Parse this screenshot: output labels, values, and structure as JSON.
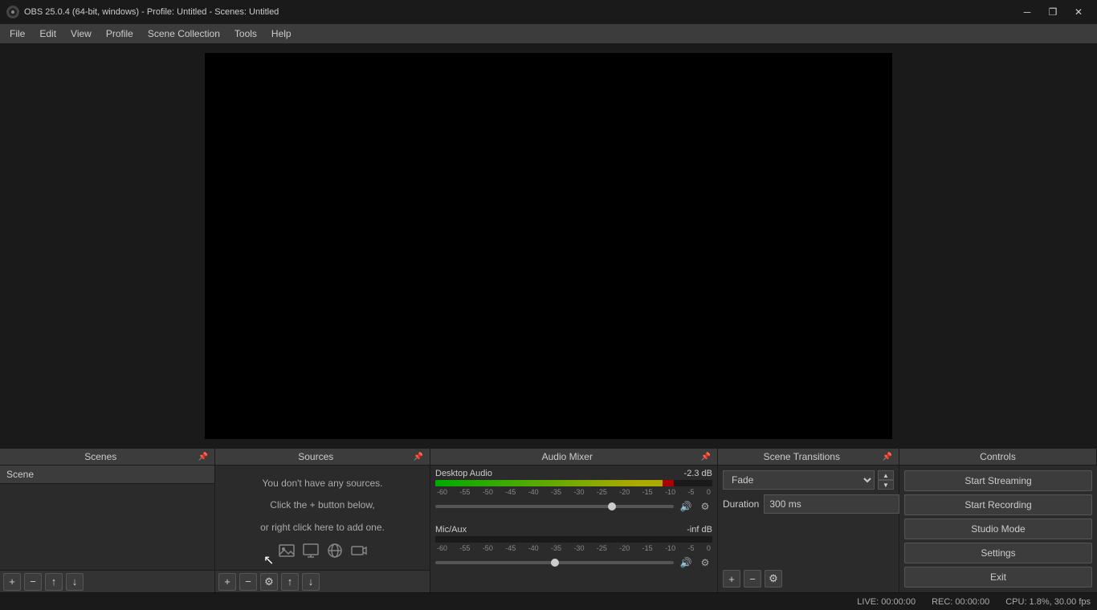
{
  "titlebar": {
    "title": "OBS 25.0.4 (64-bit, windows) - Profile: Untitled - Scenes: Untitled",
    "minimize": "─",
    "maximize": "❐",
    "close": "✕"
  },
  "menubar": {
    "items": [
      "File",
      "Edit",
      "View",
      "Profile",
      "Scene Collection",
      "Tools",
      "Help"
    ]
  },
  "panels": {
    "scenes": {
      "label": "Scenes",
      "items": [
        "Scene"
      ],
      "toolbar": {
        "add": "+",
        "remove": "−",
        "up": "↑",
        "down": "↓"
      }
    },
    "sources": {
      "label": "Sources",
      "empty_line1": "You don't have any sources.",
      "empty_line2": "Click the + button below,",
      "empty_line3": "or right click here to add one.",
      "toolbar": {
        "add": "+",
        "remove": "−",
        "settings": "⚙",
        "up": "↑",
        "down": "↓"
      }
    },
    "audiomixer": {
      "label": "Audio Mixer",
      "channels": [
        {
          "name": "Desktop Audio",
          "db": "-2.3 dB",
          "green_width_pct": 72,
          "yellow_start_pct": 72,
          "yellow_width_pct": 10,
          "red_start_pct": 82,
          "red_width_pct": 4,
          "volume_pct": 74,
          "scale": [
            "-60",
            "-55",
            "-50",
            "-45",
            "-40",
            "-35",
            "-30",
            "-25",
            "-20",
            "-15",
            "-10",
            "-5",
            "0"
          ]
        },
        {
          "name": "Mic/Aux",
          "db": "-inf dB",
          "green_width_pct": 0,
          "yellow_start_pct": 0,
          "yellow_width_pct": 0,
          "red_start_pct": 0,
          "red_width_pct": 0,
          "volume_pct": 50,
          "scale": [
            "-60",
            "-55",
            "-50",
            "-45",
            "-40",
            "-35",
            "-30",
            "-25",
            "-20",
            "-15",
            "-10",
            "-5",
            "0"
          ]
        }
      ]
    },
    "transitions": {
      "label": "Scene Transitions",
      "transition_value": "Fade",
      "duration_label": "Duration",
      "duration_value": "300 ms",
      "add": "+",
      "remove": "−",
      "settings": "⚙"
    },
    "controls": {
      "label": "Controls",
      "buttons": {
        "start_streaming": "Start Streaming",
        "start_recording": "Start Recording",
        "studio_mode": "Studio Mode",
        "settings": "Settings",
        "exit": "Exit"
      }
    }
  },
  "statusbar": {
    "live": "LIVE: 00:00:00",
    "rec": "REC: 00:00:00",
    "cpu": "CPU: 1.8%, 30.00 fps"
  }
}
